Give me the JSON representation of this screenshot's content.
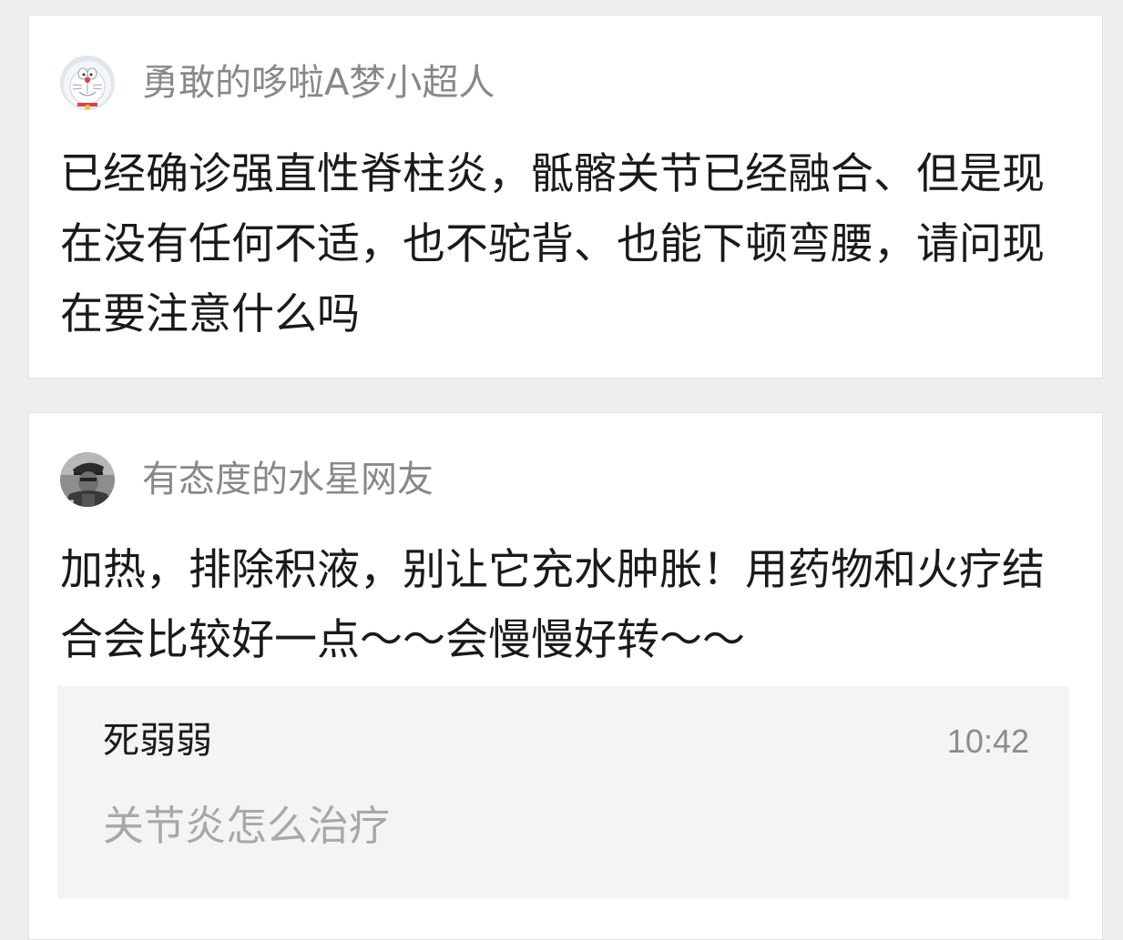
{
  "posts": [
    {
      "username": "勇敢的哆啦A梦小超人",
      "avatar_icon": "doraemon-avatar",
      "text": "已经确诊强直性脊柱炎，骶髂关节已经融合、但是现在没有任何不适，也不驼背、也能下顿弯腰，请问现在要注意什么吗"
    },
    {
      "username": "有态度的水星网友",
      "avatar_icon": "military-portrait-avatar",
      "text": "加热，排除积液，别让它充水肿胀！用药物和火疗结合会比较好一点～～会慢慢好转～～",
      "reply": {
        "username": "死弱弱",
        "time": "10:42",
        "text": "关节炎怎么治疗"
      }
    }
  ],
  "colors": {
    "page_background": "#eeeeee",
    "card_background": "#ffffff",
    "username_text": "#888888",
    "body_text": "#1a1a1a",
    "reply_background": "#f4f4f4",
    "reply_muted_text": "#a8a8a8"
  }
}
